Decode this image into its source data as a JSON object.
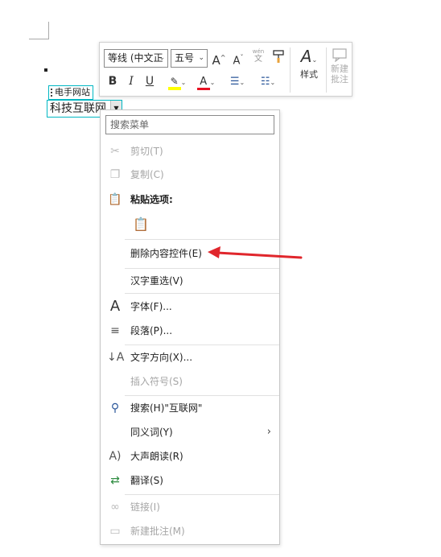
{
  "content_control": {
    "tag": "电手网站",
    "text": "科技互联网"
  },
  "mini_toolbar": {
    "font_name": "等线 (中文正",
    "font_size": "五号",
    "styles_label": "样式",
    "new_comment_label_1": "新建",
    "new_comment_label_2": "批注",
    "bold": "B",
    "italic": "I",
    "underline": "U",
    "grow": "A",
    "shrink": "A",
    "phonetic_top": "wén",
    "phonetic_bottom": "文"
  },
  "context_menu": {
    "search_placeholder": "搜索菜单",
    "items": {
      "cut": "剪切(T)",
      "copy": "复制(C)",
      "paste_options": "粘贴选项:",
      "delete_control": "删除内容控件(E)",
      "reconvert": "汉字重选(V)",
      "font": "字体(F)...",
      "paragraph": "段落(P)...",
      "text_direction": "文字方向(X)...",
      "insert_symbol": "插入符号(S)",
      "search": "搜索(H)\"互联网\"",
      "synonyms": "同义词(Y)",
      "read_aloud": "大声朗读(R)",
      "translate": "翻译(S)",
      "link": "链接(I)",
      "new_comment": "新建批注(M)"
    }
  },
  "colors": {
    "highlight": "#ffff00",
    "font_color": "#e81123",
    "control_border": "#00b7c3",
    "arrow": "#e0262c"
  }
}
